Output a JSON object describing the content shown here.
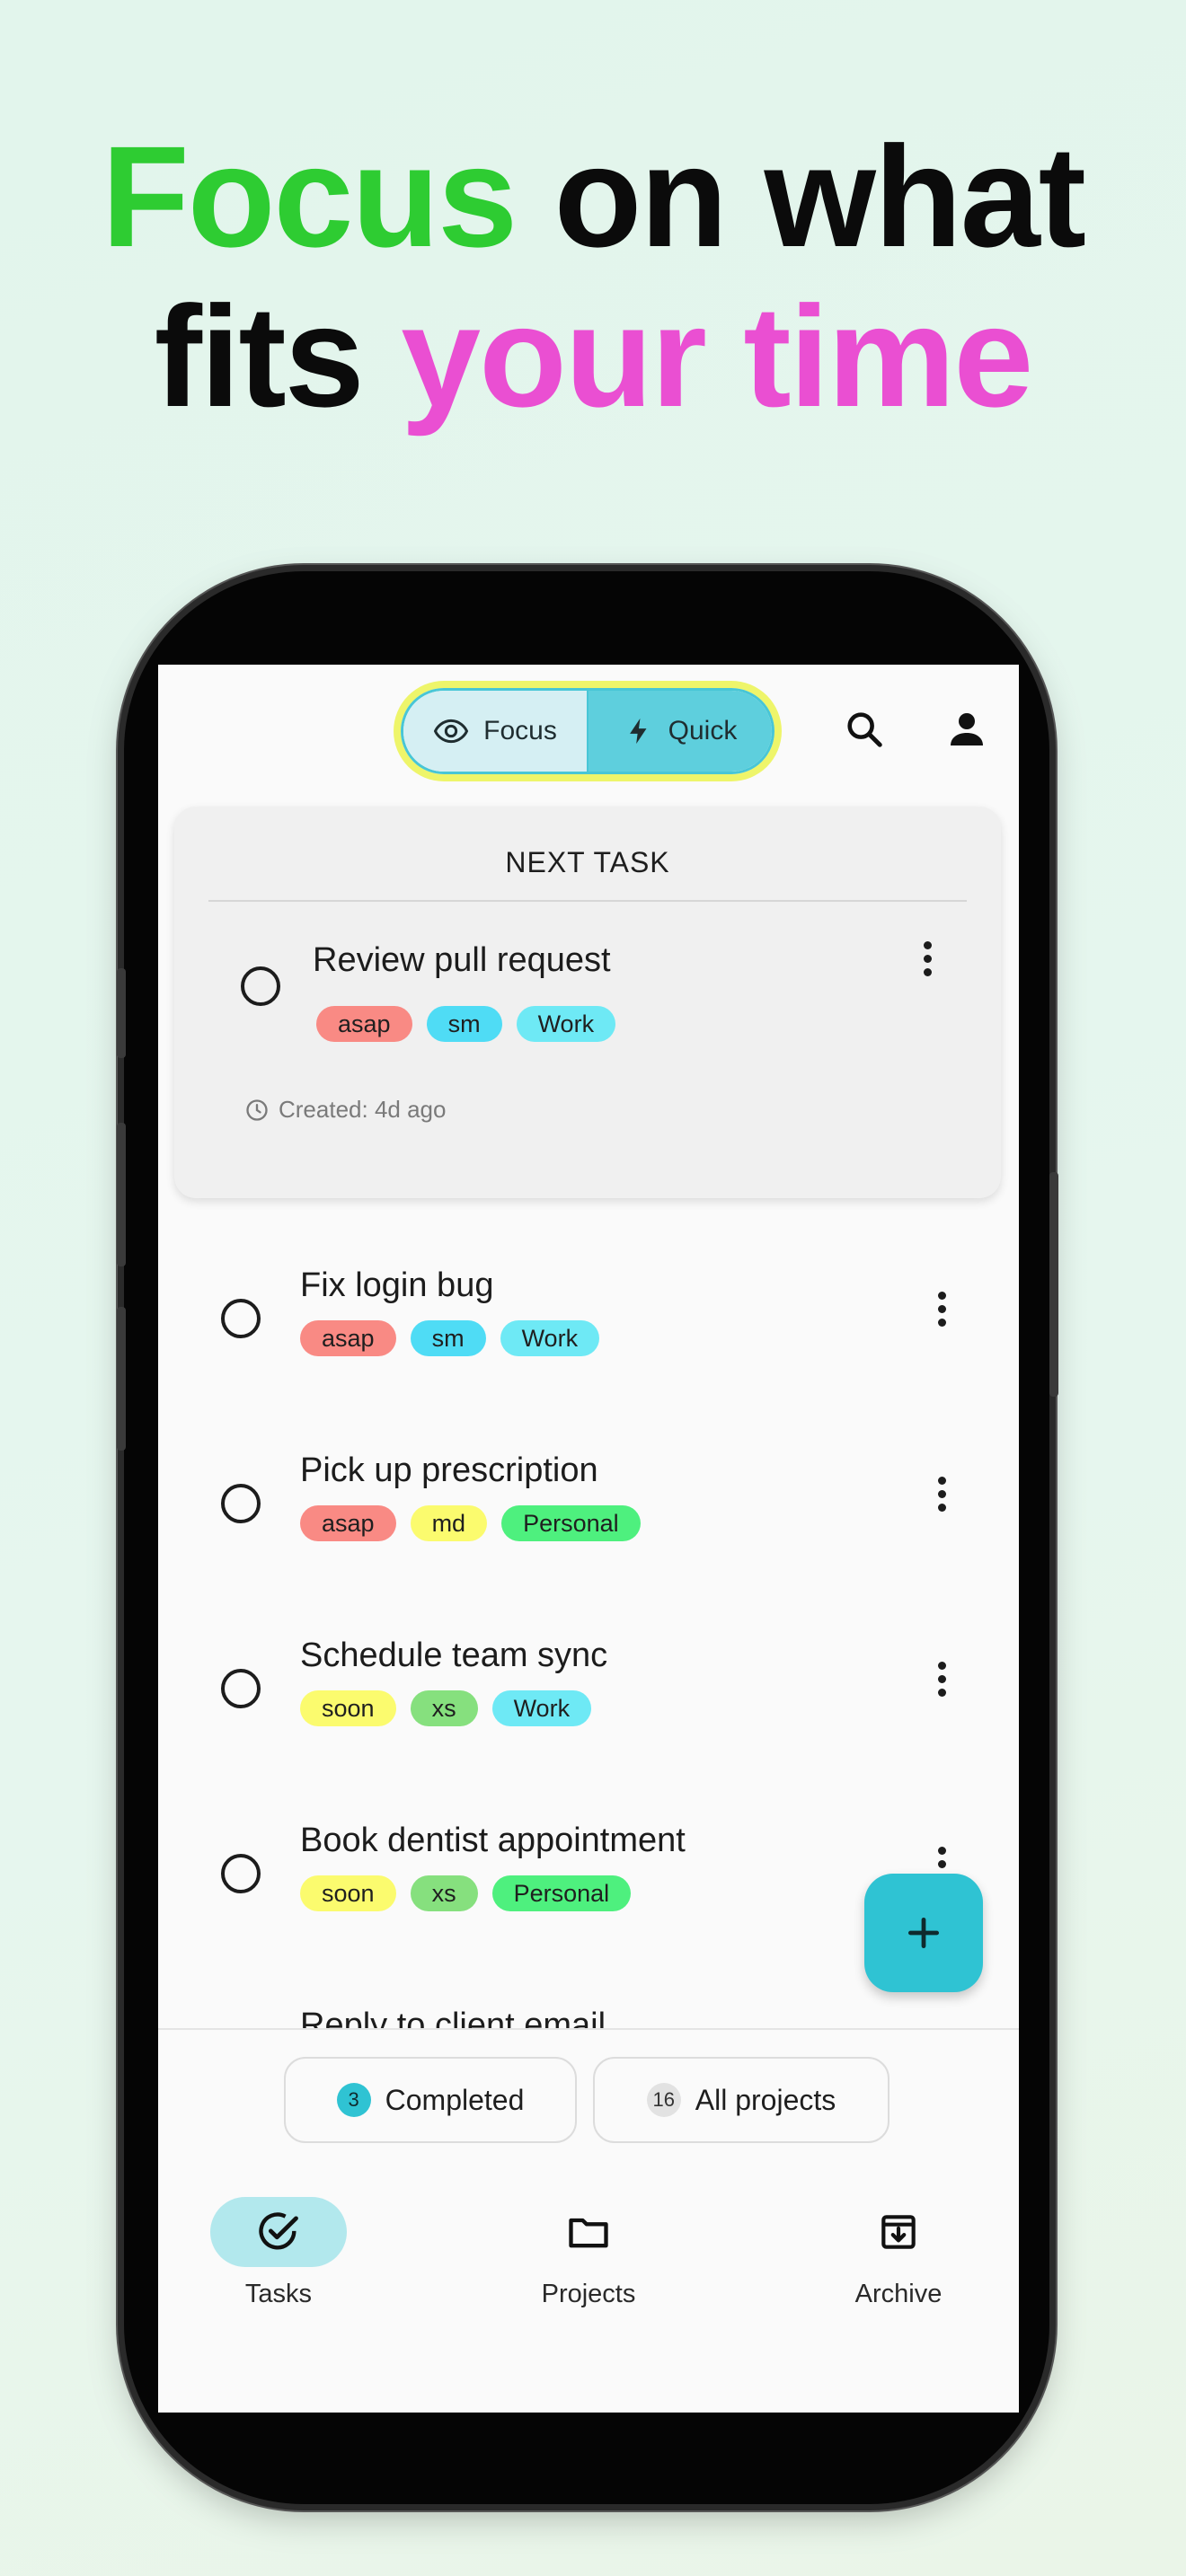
{
  "headline": {
    "line1_green": "Focus",
    "line1_rest": "on what",
    "line2_rest": "fits",
    "line2_pink": "your time"
  },
  "colors": {
    "green": "#2ecc32",
    "pink": "#ea4fd2",
    "accent": "#2fc3d3",
    "tag_red": "#f98a84",
    "tag_blue": "#4fdcf5",
    "tag_yellow": "#fbfb6e",
    "tag_green": "#4ef07e",
    "tag_lightgreen": "#86e07e"
  },
  "top_bar": {
    "focus_label": "Focus",
    "focus_icon": "eye-icon",
    "quick_label": "Quick",
    "quick_icon": "lightning-icon",
    "search_icon": "search-icon",
    "account_icon": "person-icon"
  },
  "next_task": {
    "header": "NEXT TASK",
    "title": "Review pull request",
    "tags": [
      "asap",
      "sm",
      "Work"
    ],
    "created": "Created: 4d ago"
  },
  "tasks": [
    {
      "title": "Fix login bug",
      "tags": [
        "asap",
        "sm",
        "Work"
      ]
    },
    {
      "title": "Pick up prescription",
      "tags": [
        "asap",
        "md",
        "Personal"
      ]
    },
    {
      "title": "Schedule team sync",
      "tags": [
        "soon",
        "xs",
        "Work"
      ]
    },
    {
      "title": "Book dentist appointment",
      "tags": [
        "soon",
        "xs",
        "Personal"
      ]
    },
    {
      "title": "Reply to client email",
      "tags": []
    }
  ],
  "chips": {
    "completed_count": "3",
    "completed_label": "Completed",
    "projects_count": "16",
    "projects_label": "All projects"
  },
  "nav": {
    "tasks": "Tasks",
    "projects": "Projects",
    "archive": "Archive"
  }
}
